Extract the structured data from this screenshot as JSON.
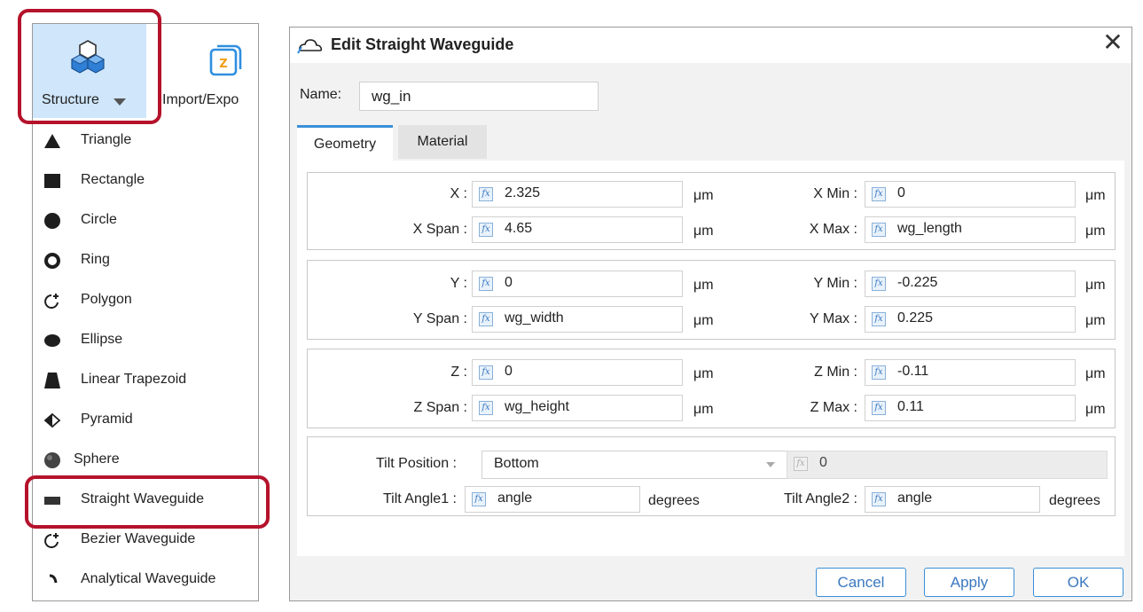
{
  "ribbon": {
    "structure_label": "Structure",
    "import_label": "Import/Expo"
  },
  "shapes": [
    {
      "label": "Triangle",
      "icon": "triangle-icon"
    },
    {
      "label": "Rectangle",
      "icon": "rectangle-icon"
    },
    {
      "label": "Circle",
      "icon": "circle-icon"
    },
    {
      "label": "Ring",
      "icon": "ring-icon"
    },
    {
      "label": "Polygon",
      "icon": "polygon-icon"
    },
    {
      "label": "Ellipse",
      "icon": "ellipse-icon"
    },
    {
      "label": "Linear Trapezoid",
      "icon": "trapezoid-icon"
    },
    {
      "label": "Pyramid",
      "icon": "pyramid-icon"
    },
    {
      "label": "Sphere",
      "icon": "sphere-icon"
    },
    {
      "label": "Straight Waveguide",
      "icon": "straight-waveguide-icon"
    },
    {
      "label": "Bezier Waveguide",
      "icon": "bezier-waveguide-icon"
    },
    {
      "label": "Analytical Waveguide",
      "icon": "analytical-waveguide-icon"
    }
  ],
  "dialog": {
    "title": "Edit Straight Waveguide",
    "close_glyph": "✕",
    "name_label": "Name:",
    "name_value": "wg_in",
    "tabs": [
      "Geometry",
      "Material"
    ],
    "fx_glyph": "fx",
    "x": {
      "x_label": "X :",
      "x_value": "2.325",
      "x_unit": "μm",
      "xmin_label": "X Min :",
      "xmin_value": "0",
      "xmin_unit": "μm",
      "xspan_label": "X Span :",
      "xspan_value": "4.65",
      "xspan_unit": "μm",
      "xmax_label": "X Max :",
      "xmax_value": "wg_length",
      "xmax_unit": "μm"
    },
    "y": {
      "y_label": "Y :",
      "y_value": "0",
      "y_unit": "μm",
      "ymin_label": "Y Min :",
      "ymin_value": "-0.225",
      "ymin_unit": "μm",
      "yspan_label": "Y Span :",
      "yspan_value": "wg_width",
      "yspan_unit": "μm",
      "ymax_label": "Y Max :",
      "ymax_value": "0.225",
      "ymax_unit": "μm"
    },
    "z": {
      "z_label": "Z :",
      "z_value": "0",
      "z_unit": "μm",
      "zmin_label": "Z Min :",
      "zmin_value": "-0.11",
      "zmin_unit": "μm",
      "zspan_label": "Z Span :",
      "zspan_value": "wg_height",
      "zspan_unit": "μm",
      "zmax_label": "Z Max :",
      "zmax_value": "0.11",
      "zmax_unit": "μm"
    },
    "tilt": {
      "position_label": "Tilt Position :",
      "position_value": "Bottom",
      "position_extra_value": "0",
      "angle1_label": "Tilt Angle1 :",
      "angle1_value": "angle",
      "angle1_unit": "degrees",
      "angle2_label": "Tilt Angle2 :",
      "angle2_value": "angle",
      "angle2_unit": "degrees"
    },
    "buttons": {
      "cancel": "Cancel",
      "apply": "Apply",
      "ok": "OK"
    }
  },
  "colors": {
    "highlight_red": "#b5122b",
    "accent_blue": "#3a8fd8",
    "ribbon_selected": "#cfe6fb"
  }
}
